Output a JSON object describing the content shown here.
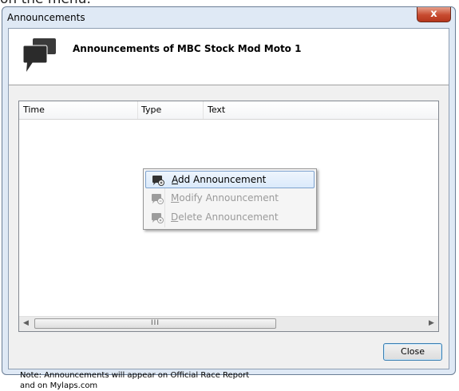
{
  "caption_fragment": "on the menu.",
  "window": {
    "title": "Announcements",
    "close_glyph": "x"
  },
  "header": {
    "title": "Announcements of MBC Stock Mod Moto 1",
    "icon": "speech-bubble-icon"
  },
  "list": {
    "columns": [
      "Time",
      "Type",
      "Text"
    ],
    "rows": [],
    "scroll_thumb_grip": "III"
  },
  "context_menu": {
    "items": [
      {
        "label": "Add Announcement",
        "mnemonic": "A",
        "enabled": true,
        "highlighted": true,
        "icon": "add-announcement-icon"
      },
      {
        "label": "Modify Announcement",
        "mnemonic": "M",
        "enabled": false,
        "highlighted": false,
        "icon": "modify-announcement-icon"
      },
      {
        "label": "Delete Announcement",
        "mnemonic": "D",
        "enabled": false,
        "highlighted": false,
        "icon": "delete-announcement-icon"
      }
    ]
  },
  "footer": {
    "note_line1": "Note: Announcements will appear on Official Race Report",
    "note_line2": "and on Mylaps.com",
    "close_label": "Close"
  },
  "colors": {
    "menu_highlight_border": "#7da2ce",
    "close_button": "#c74a2f",
    "accent_border": "#3c7fb1"
  }
}
